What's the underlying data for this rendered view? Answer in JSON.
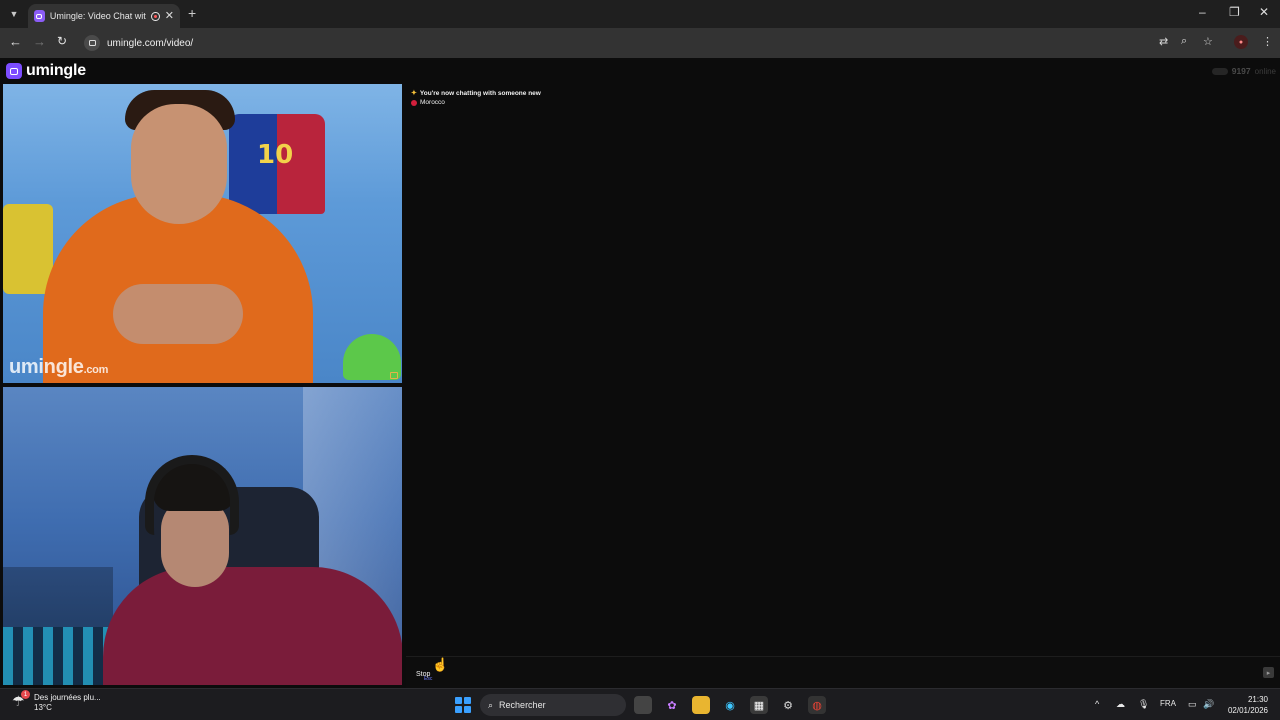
{
  "browser": {
    "tab_title": "Umingle: Video Chat with S",
    "url": "umingle.com/video/",
    "new_tab_label": "+",
    "window_controls": {
      "minimize": "–",
      "restore": "❐",
      "close": "✕"
    }
  },
  "site": {
    "brand": "umingle",
    "online_count": "9197",
    "online_label": "online"
  },
  "videos": {
    "stranger_watermark": "umingle",
    "stranger_watermark_suffix": ".com",
    "jersey_number": "10"
  },
  "chat": {
    "system_message": "You're now chatting with someone new",
    "stranger_country": "Morocco",
    "stop_label": "Stop",
    "stop_hint": "Esc",
    "input_placeholder": ""
  },
  "taskbar": {
    "weather_text": "Des journées plu...",
    "weather_temp": "13°C",
    "weather_badge": "1",
    "search_label": "Rechercher",
    "language": "FRA",
    "time": "21:30",
    "date": "02/01/2026"
  },
  "icons": {
    "tab_list": "chevron-down-icon",
    "translate": "translate-icon",
    "zoom": "zoom-icon",
    "bookmark": "star-icon",
    "menu": "kebab-menu-icon"
  },
  "colors": {
    "brand": "#7c4dff",
    "page_bg": "#0c0c0c",
    "country_flag": "#d21f3c"
  }
}
